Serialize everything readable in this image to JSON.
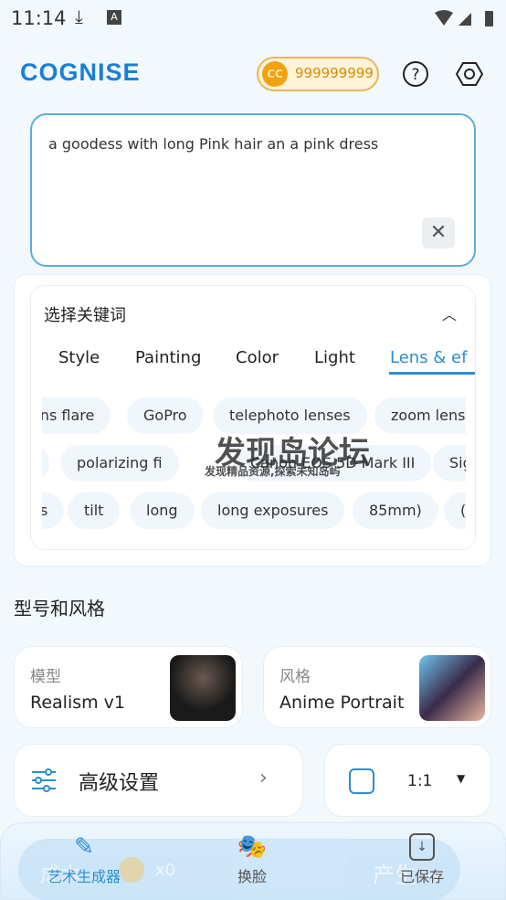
{
  "status_bar": {
    "time": "11:14"
  },
  "header": {
    "logo": "COGNISE",
    "coin_symbol": "CC",
    "coins": "999999999",
    "help_icon": "question-icon",
    "settings_icon": "hexagon-gear-icon"
  },
  "prompt": {
    "value": "a goodess with long Pink hair an a pink  dress",
    "clear": "✕"
  },
  "keywords": {
    "title": "选择关键词",
    "tabs": [
      "Style",
      "Painting",
      "Color",
      "Light",
      "Lens & ef"
    ],
    "active_tab": "Lens & ef",
    "rows": [
      [
        "ens flare",
        "GoPro",
        "telephoto lenses",
        "zoom lens"
      ],
      [
        "",
        "polarizing fi",
        "Canon EOS 5D Mark III",
        "Sig"
      ],
      [
        "s",
        "tilt",
        "long",
        "long exposures",
        "85mm)",
        "("
      ]
    ]
  },
  "section": {
    "title": "型号和风格"
  },
  "model": {
    "label": "模型",
    "value": "Realism v1"
  },
  "style": {
    "label": "风格",
    "value": "Anime Portrait"
  },
  "advanced": {
    "label": "高级设置"
  },
  "ratio": {
    "value": "1:1"
  },
  "generate_bar": {
    "cost_label": "成本:",
    "cost": "x0",
    "action": "产生 →"
  },
  "nav": [
    {
      "label": "艺术生成器",
      "active": true
    },
    {
      "label": "换脸"
    },
    {
      "label": "已保存"
    }
  ],
  "watermark": {
    "title": "发现岛论坛",
    "subtitle": "发现精品资源,探索未知岛屿"
  },
  "colors": {
    "accent": "#2a8fd0",
    "coin": "#f1a210"
  }
}
